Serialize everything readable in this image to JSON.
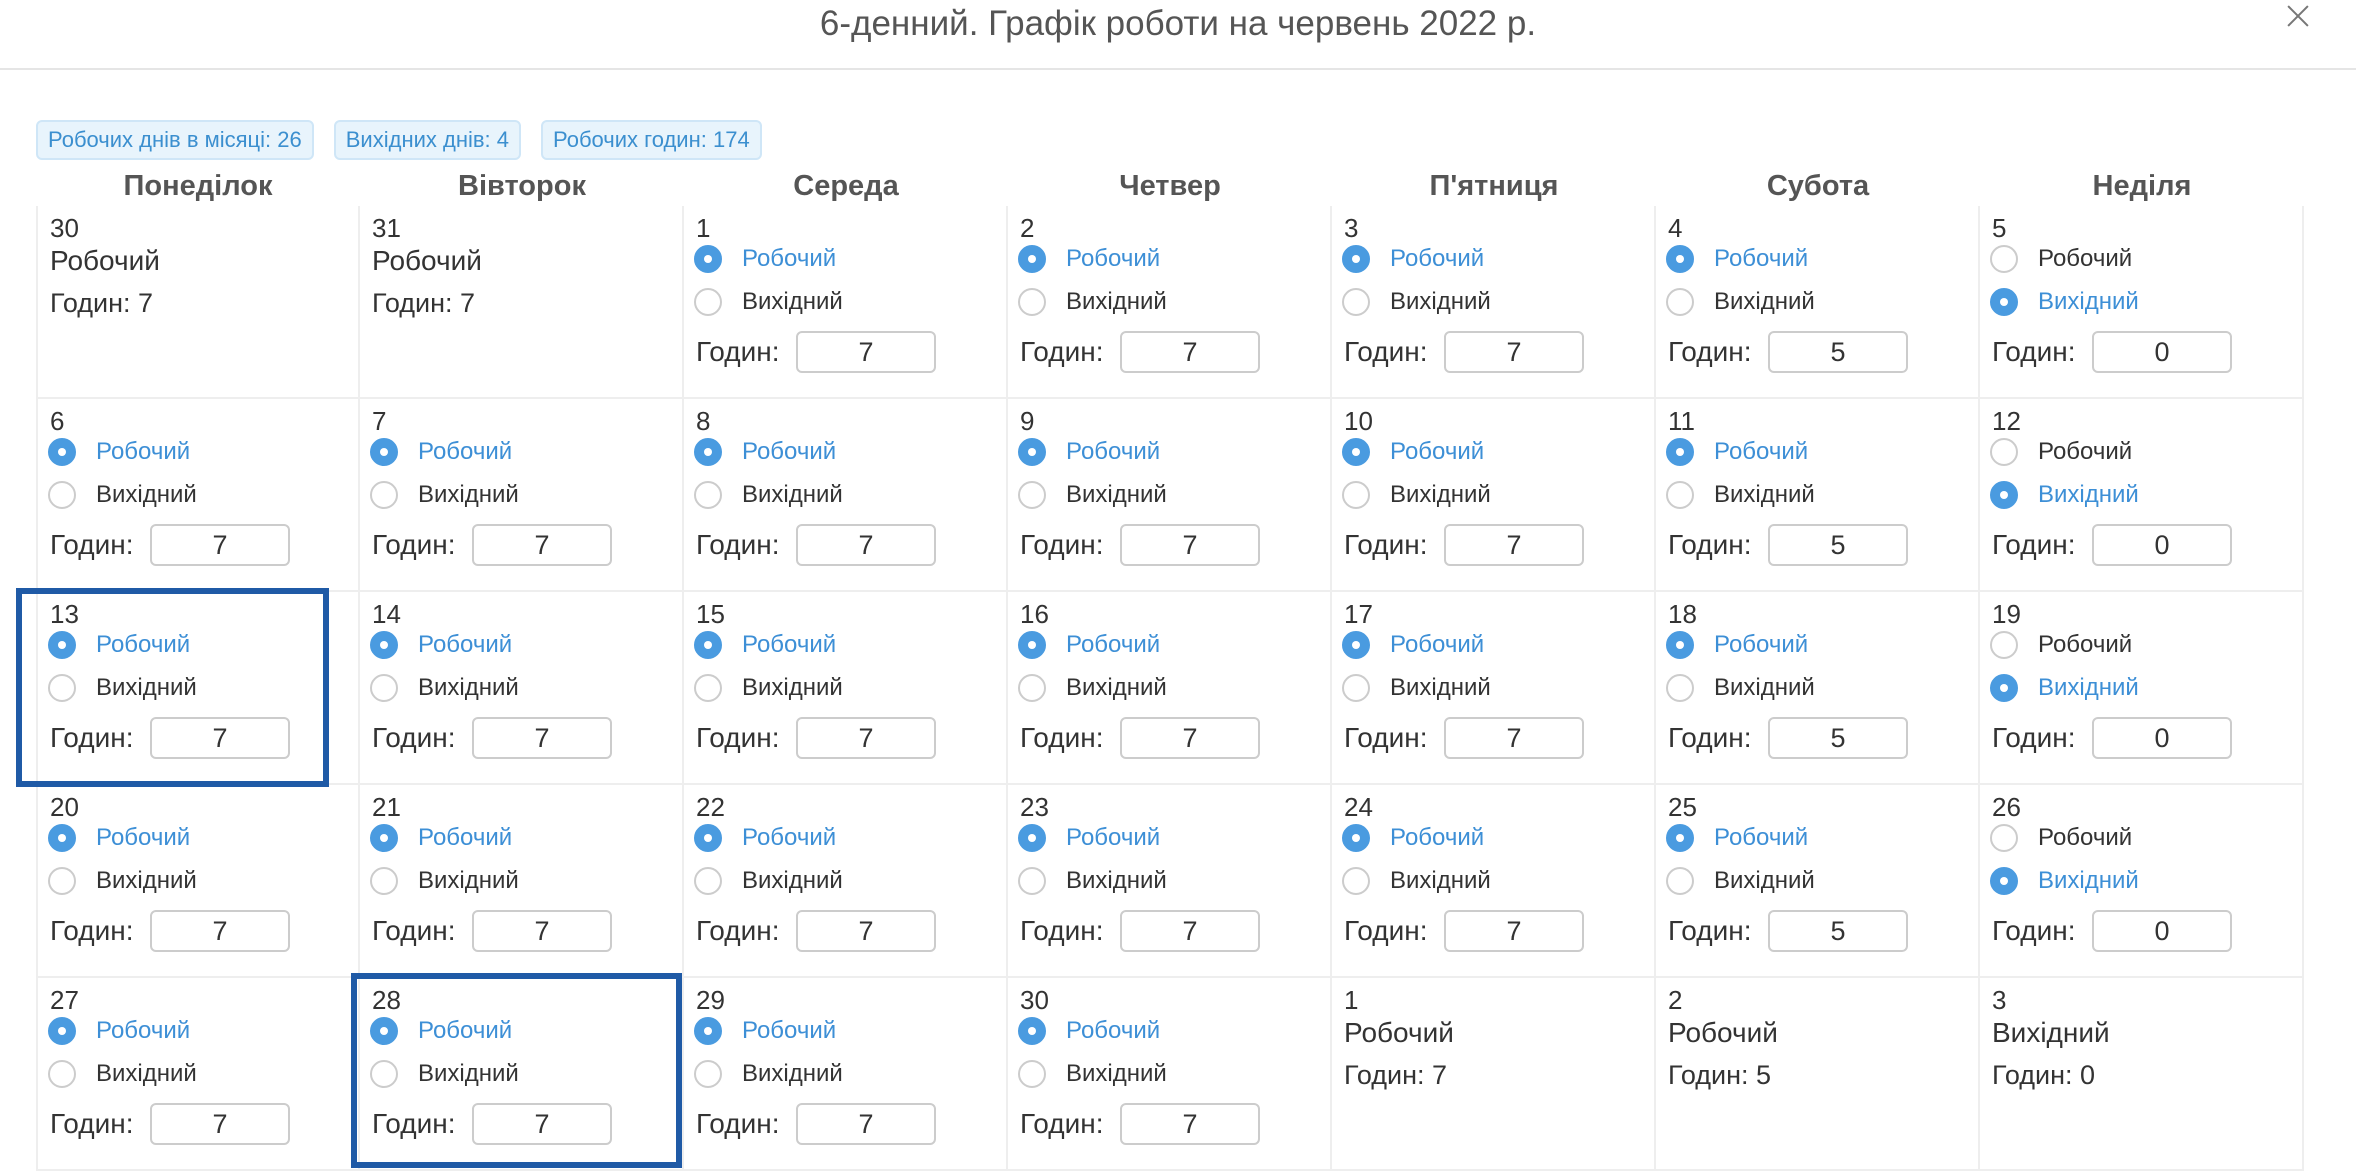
{
  "modal": {
    "title": "6-денний. Графік роботи на червень 2022 р.",
    "close_label": "×"
  },
  "stats": [
    "Робочих днів в місяці: 26",
    "Вихідних днів: 4",
    "Робочих годин: 174"
  ],
  "weekdays": [
    "Понеділок",
    "Вівторок",
    "Середа",
    "Четвер",
    "П'ятниця",
    "Субота",
    "Неділя"
  ],
  "labels": {
    "working": "Робочий",
    "dayoff": "Вихідний",
    "hours": "Годин:"
  },
  "days": [
    {
      "num": "30",
      "editable": false,
      "type": "Робочий",
      "hours_text": "Годин: 7"
    },
    {
      "num": "31",
      "editable": false,
      "type": "Робочий",
      "hours_text": "Годин: 7"
    },
    {
      "num": "1",
      "editable": true,
      "working": true,
      "hours": "7"
    },
    {
      "num": "2",
      "editable": true,
      "working": true,
      "hours": "7"
    },
    {
      "num": "3",
      "editable": true,
      "working": true,
      "hours": "7"
    },
    {
      "num": "4",
      "editable": true,
      "working": true,
      "hours": "5"
    },
    {
      "num": "5",
      "editable": true,
      "working": false,
      "hours": "0"
    },
    {
      "num": "6",
      "editable": true,
      "working": true,
      "hours": "7"
    },
    {
      "num": "7",
      "editable": true,
      "working": true,
      "hours": "7"
    },
    {
      "num": "8",
      "editable": true,
      "working": true,
      "hours": "7"
    },
    {
      "num": "9",
      "editable": true,
      "working": true,
      "hours": "7"
    },
    {
      "num": "10",
      "editable": true,
      "working": true,
      "hours": "7"
    },
    {
      "num": "11",
      "editable": true,
      "working": true,
      "hours": "5"
    },
    {
      "num": "12",
      "editable": true,
      "working": false,
      "hours": "0"
    },
    {
      "num": "13",
      "editable": true,
      "working": true,
      "hours": "7"
    },
    {
      "num": "14",
      "editable": true,
      "working": true,
      "hours": "7"
    },
    {
      "num": "15",
      "editable": true,
      "working": true,
      "hours": "7"
    },
    {
      "num": "16",
      "editable": true,
      "working": true,
      "hours": "7"
    },
    {
      "num": "17",
      "editable": true,
      "working": true,
      "hours": "7"
    },
    {
      "num": "18",
      "editable": true,
      "working": true,
      "hours": "5"
    },
    {
      "num": "19",
      "editable": true,
      "working": false,
      "hours": "0"
    },
    {
      "num": "20",
      "editable": true,
      "working": true,
      "hours": "7"
    },
    {
      "num": "21",
      "editable": true,
      "working": true,
      "hours": "7"
    },
    {
      "num": "22",
      "editable": true,
      "working": true,
      "hours": "7"
    },
    {
      "num": "23",
      "editable": true,
      "working": true,
      "hours": "7"
    },
    {
      "num": "24",
      "editable": true,
      "working": true,
      "hours": "7"
    },
    {
      "num": "25",
      "editable": true,
      "working": true,
      "hours": "5"
    },
    {
      "num": "26",
      "editable": true,
      "working": false,
      "hours": "0"
    },
    {
      "num": "27",
      "editable": true,
      "working": true,
      "hours": "7"
    },
    {
      "num": "28",
      "editable": true,
      "working": true,
      "hours": "7"
    },
    {
      "num": "29",
      "editable": true,
      "working": true,
      "hours": "7"
    },
    {
      "num": "30",
      "editable": true,
      "working": true,
      "hours": "7"
    },
    {
      "num": "1",
      "editable": false,
      "type": "Робочий",
      "hours_text": "Годин: 7"
    },
    {
      "num": "2",
      "editable": false,
      "type": "Робочий",
      "hours_text": "Годин: 5"
    },
    {
      "num": "3",
      "editable": false,
      "type": "Вихідний",
      "hours_text": "Годин: 0"
    }
  ],
  "highlighted_days": [
    "13",
    "28"
  ],
  "colors": {
    "accent": "#4a9be0",
    "highlight_border": "#1f5aa6",
    "badge_bg": "#e8f4fc",
    "badge_text": "#3b8fcf"
  }
}
